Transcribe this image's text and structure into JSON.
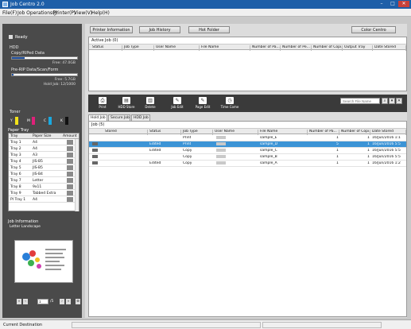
{
  "window": {
    "title": "Job Centro 2.0",
    "min": "–",
    "max": "□",
    "close": "✕"
  },
  "menu": [
    "File(F)",
    "Job Operations(J)",
    "Printer(P)",
    "View(V)",
    "Help(H)"
  ],
  "left": {
    "status": "Ready",
    "hdd_label": "HDD",
    "copy_label": "Copy/RIPed Data",
    "copy_free": "Free: 47.0GB",
    "copy_fill_pct": 20,
    "prerip_label": "Pre-RIP Data/Scan/Form",
    "prerip_free": "Free: 5.7GB",
    "prerip_fill_pct": 3,
    "hold_jobs": "Hold Job: 12/1000",
    "toner_label": "Toner",
    "toners": [
      {
        "label": "Y",
        "color": "#f2e21a"
      },
      {
        "label": "M",
        "color": "#e0207a"
      },
      {
        "label": "C",
        "color": "#19a9e0"
      },
      {
        "label": "K",
        "color": "#111111"
      }
    ],
    "paper_tray_label": "Paper Tray",
    "tray_headers": [
      "Tray",
      "Paper Size",
      "Amount"
    ],
    "trays": [
      {
        "tray": "Tray 1",
        "size": "A4"
      },
      {
        "tray": "Tray 2",
        "size": "A4"
      },
      {
        "tray": "Tray 3",
        "size": "A3"
      },
      {
        "tray": "Tray 4",
        "size": "JIS-B5"
      },
      {
        "tray": "Tray 5",
        "size": "JIS-B5"
      },
      {
        "tray": "Tray 6",
        "size": "JIS-B4"
      },
      {
        "tray": "Tray 7",
        "size": "Letter"
      },
      {
        "tray": "Tray 8",
        "size": "9x11"
      },
      {
        "tray": "Tray 9",
        "size": "Tabbed Extra"
      },
      {
        "tray": "PI Tray 1",
        "size": "A4"
      }
    ],
    "job_info_label": "Job Information",
    "job_info_value": "Letter Landscape",
    "page_current": "1",
    "page_total": "/5"
  },
  "top_buttons": [
    "Printer Information",
    "Job History",
    "Hot Folder",
    "Color Centro"
  ],
  "active_job": {
    "title": "Active Job (0)",
    "headers": [
      "Status",
      "Job Type",
      "User Name",
      "File Name",
      "Number of Pa...",
      "Number of Pe...",
      "Number of Copi...",
      "Output Tray",
      "Date Stored"
    ]
  },
  "toolbar": {
    "buttons": [
      "Print",
      "HDD Store",
      "Delete",
      "Job Edit",
      "Page Edit",
      "Time Come"
    ],
    "search_placeholder": "Search File Name"
  },
  "tabs": [
    "Hold Job",
    "Secure Job",
    "HDD Job"
  ],
  "job_list": {
    "title": "Job (5)",
    "headers": [
      "Stored",
      "Status",
      "Job Type",
      "User Name",
      "File Name",
      "Number of Pa...",
      "Number of Copi...",
      "Date Stored"
    ],
    "rows": [
      {
        "status": "",
        "type": "Print",
        "file": "sample_E",
        "pages": "1",
        "copies": "1",
        "date": "16/Jun/2016 1:1"
      },
      {
        "status": "Edited",
        "type": "Print",
        "file": "sample_D",
        "pages": "5",
        "copies": "1",
        "date": "16/Jun/2016 5:5"
      },
      {
        "status": "Edited",
        "type": "Copy",
        "file": "sample_C",
        "pages": "1",
        "copies": "1",
        "date": "16/Jun/2016 5:5"
      },
      {
        "status": "",
        "type": "Copy",
        "file": "sample_B",
        "pages": "1",
        "copies": "1",
        "date": "16/Jun/2016 5:5"
      },
      {
        "status": "Edited",
        "type": "Copy",
        "file": "sample_A",
        "pages": "1",
        "copies": "1",
        "date": "16/Jun/2016 1:2"
      }
    ]
  },
  "statusbar": {
    "text": "Current Destination"
  }
}
